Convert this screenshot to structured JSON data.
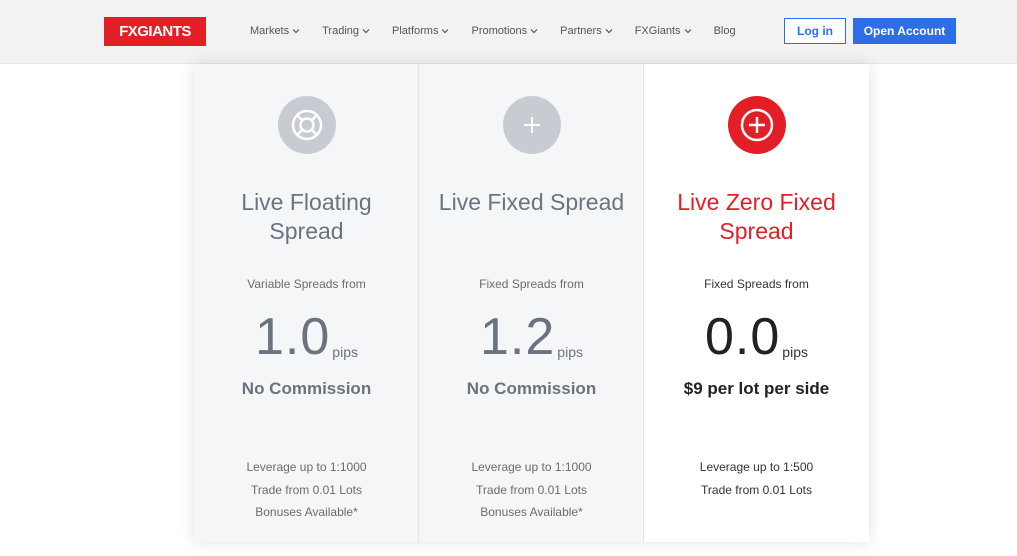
{
  "header": {
    "logo": "FXGIANTS",
    "nav": [
      {
        "label": "Markets",
        "dropdown": true
      },
      {
        "label": "Trading",
        "dropdown": true
      },
      {
        "label": "Platforms",
        "dropdown": true
      },
      {
        "label": "Promotions",
        "dropdown": true
      },
      {
        "label": "Partners",
        "dropdown": true
      },
      {
        "label": "FXGiants",
        "dropdown": true
      },
      {
        "label": "Blog",
        "dropdown": false
      }
    ],
    "login_label": "Log in",
    "open_account_label": "Open Account"
  },
  "colors": {
    "brand_red": "#e41e26",
    "primary_blue": "#2d6ee8",
    "muted_gray": "#6b7280"
  },
  "cards": [
    {
      "icon": "lifebuoy-icon",
      "title": "Live Floating Spread",
      "subtitle": "Variable Spreads from",
      "spread": "1.0",
      "unit": "pips",
      "commission": "No Commission",
      "features": [
        "Leverage up to 1:1000",
        "Trade from 0.01 Lots",
        "Bonuses Available*"
      ]
    },
    {
      "icon": "plus-icon",
      "title": "Live Fixed Spread",
      "subtitle": "Fixed Spreads from",
      "spread": "1.2",
      "unit": "pips",
      "commission": "No Commission",
      "features": [
        "Leverage up to 1:1000",
        "Trade from 0.01 Lots",
        "Bonuses Available*"
      ]
    },
    {
      "icon": "plus-circle-icon",
      "title": "Live Zero Fixed Spread",
      "subtitle": "Fixed Spreads from",
      "spread": "0.0",
      "unit": "pips",
      "commission": "$9 per lot per side",
      "features": [
        "Leverage up to 1:500",
        "Trade from 0.01 Lots"
      ]
    }
  ]
}
